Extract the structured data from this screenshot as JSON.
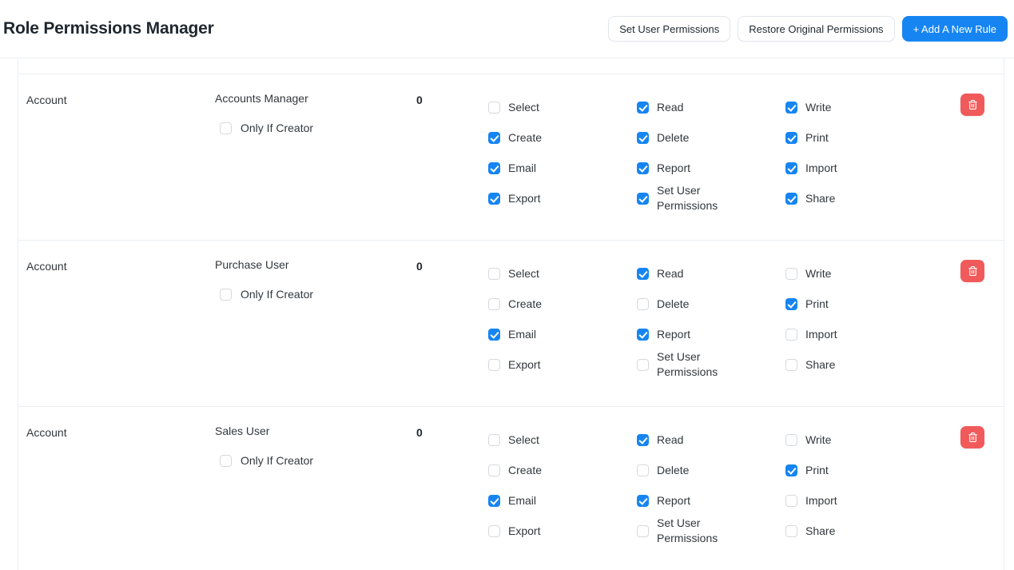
{
  "header": {
    "title": "Role Permissions Manager",
    "buttons": [
      {
        "label": "Set User Permissions",
        "style": "secondary",
        "name": "set-user-permissions-button"
      },
      {
        "label": "Restore Original Permissions",
        "style": "secondary",
        "name": "restore-original-permissions-button"
      },
      {
        "label": "+ Add A New Rule",
        "style": "primary",
        "name": "add-a-new-rule-button"
      }
    ]
  },
  "table": {
    "only_if_creator_label": "Only If Creator",
    "delete_icon": "trash-icon",
    "columns": {
      "col1": [
        "Select",
        "Create",
        "Email",
        "Export"
      ],
      "col2": [
        "Read",
        "Delete",
        "Report",
        "Set User Permissions"
      ],
      "col3": [
        "Write",
        "Print",
        "Import",
        "Share"
      ]
    },
    "rows": [
      {
        "doctype": "Account",
        "role": "Accounts Manager",
        "level": "0",
        "only_if_creator": false,
        "perms": {
          "Select": false,
          "Create": true,
          "Email": true,
          "Export": true,
          "Read": true,
          "Delete": true,
          "Report": true,
          "Set User Permissions": true,
          "Write": true,
          "Print": true,
          "Import": true,
          "Share": true
        }
      },
      {
        "doctype": "Account",
        "role": "Purchase User",
        "level": "0",
        "only_if_creator": false,
        "perms": {
          "Select": false,
          "Create": false,
          "Email": true,
          "Export": false,
          "Read": true,
          "Delete": false,
          "Report": true,
          "Set User Permissions": false,
          "Write": false,
          "Print": true,
          "Import": false,
          "Share": false
        }
      },
      {
        "doctype": "Account",
        "role": "Sales User",
        "level": "0",
        "only_if_creator": false,
        "perms": {
          "Select": false,
          "Create": false,
          "Email": true,
          "Export": false,
          "Read": true,
          "Delete": false,
          "Report": true,
          "Set User Permissions": false,
          "Write": false,
          "Print": true,
          "Import": false,
          "Share": false
        }
      }
    ]
  },
  "colors": {
    "accent": "#1685f2",
    "danger": "#f15a5a",
    "text": "#32373c",
    "border": "#ebeef1"
  }
}
